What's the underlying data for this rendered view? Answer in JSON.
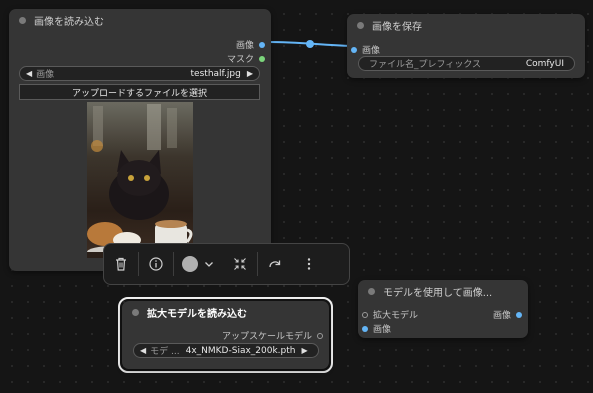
{
  "load_image_node": {
    "title": "画像を読み込む",
    "outputs": [
      "画像",
      "マスク"
    ],
    "image_widget": {
      "label": "画像",
      "value": "testhalf.jpg"
    },
    "upload_button": "アップロードするファイルを選択"
  },
  "save_image_node": {
    "title": "画像を保存",
    "input_label": "画像",
    "prefix_widget": {
      "label": "ファイル名_プレフィックス",
      "value": "ComfyUI"
    }
  },
  "upscale_loader_node": {
    "title": "拡大モデルを読み込む",
    "output_label": "アップスケールモデル",
    "model_widget": {
      "label": "モデ ...",
      "value": "4x_NMKD-Siax_200k.pth"
    }
  },
  "upscale_with_model_node": {
    "title": "モデルを使用して画像...",
    "inputs": [
      "拡大モデル",
      "画像"
    ],
    "output_label": "画像"
  },
  "toolbar": {
    "icons": [
      "trash-icon",
      "info-icon",
      "color-picker-icon",
      "chevron-down-icon",
      "collapse-icon",
      "bypass-icon",
      "more-icon"
    ]
  },
  "colors": {
    "canvas": "#151515",
    "node_body": "#353535",
    "image_link": "#64b5f6",
    "mask_slot": "#7cd67c",
    "selection": "#f2f2f2"
  }
}
